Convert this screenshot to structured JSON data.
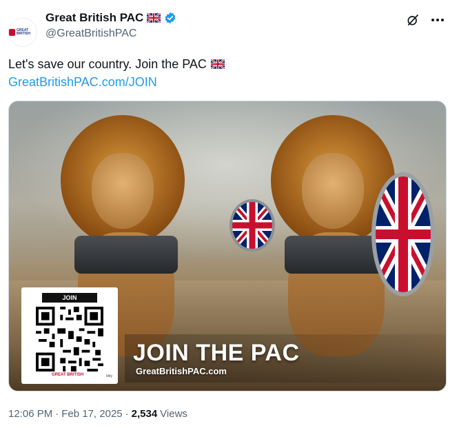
{
  "account": {
    "display_name": "Great British PAC",
    "handle": "@GreatBritishPAC",
    "avatar_text": "GREAT BRITISH"
  },
  "icons": {
    "flag": "union-jack-flag-icon",
    "verified": "verified-badge-icon",
    "grok": "grok-icon",
    "more": "more-icon"
  },
  "tweet": {
    "text": "Let's save our country. Join the PAC",
    "link": "GreatBritishPAC.com/JOIN"
  },
  "media": {
    "qr_label": "JOIN",
    "qr_brand": "GREAT BRITISH",
    "qr_bitly": "bitly",
    "banner_title": "JOIN THE PAC",
    "banner_url": "GreatBritishPAC.com"
  },
  "meta": {
    "time": "12:06 PM",
    "separator": "·",
    "date": "Feb 17, 2025",
    "separator2": "·",
    "views_count": "2,534",
    "views_label": "Views"
  },
  "colors": {
    "link": "#1d9bf0",
    "verified": "#1d9bf0",
    "secondary_text": "#536471"
  }
}
